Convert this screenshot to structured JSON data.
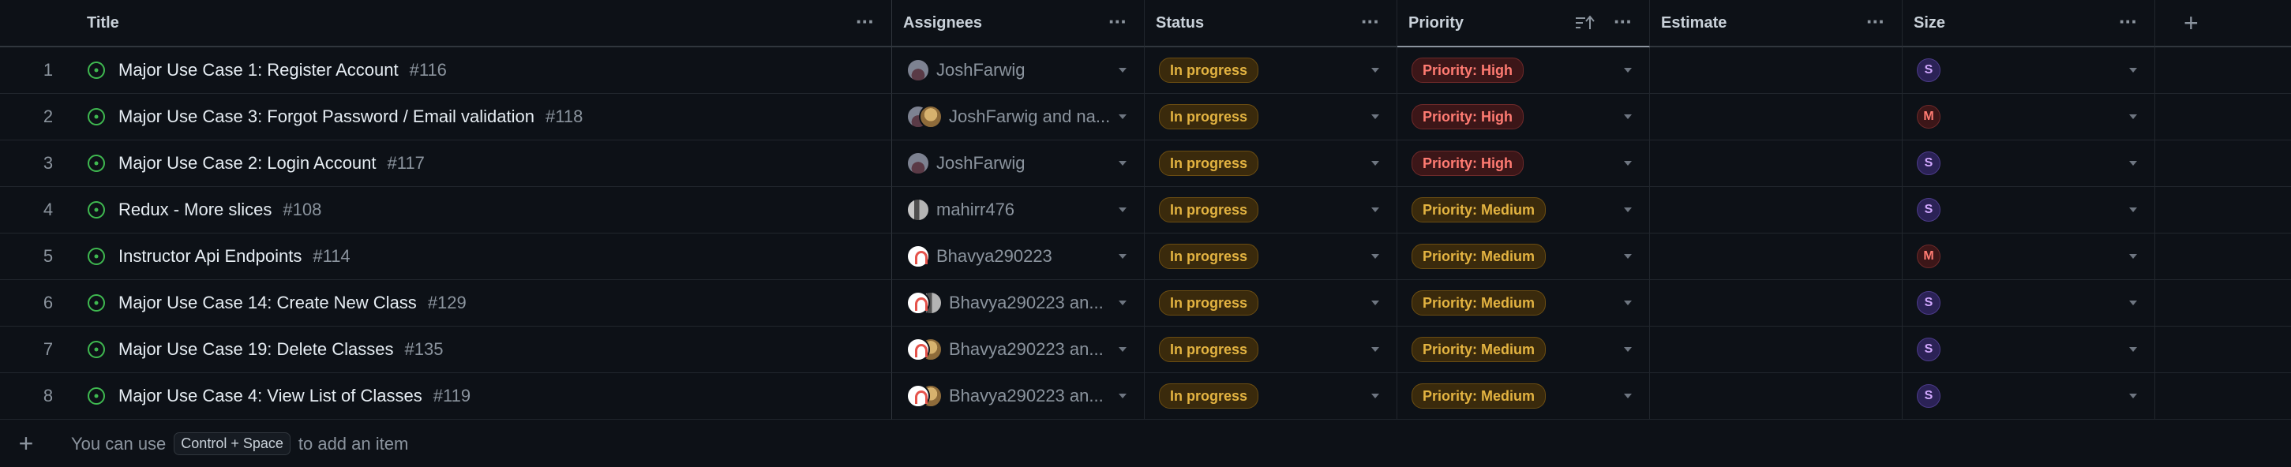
{
  "columns": {
    "title": "Title",
    "assignees": "Assignees",
    "status": "Status",
    "priority": "Priority",
    "estimate": "Estimate",
    "size": "Size",
    "add_field": "+"
  },
  "rows": [
    {
      "num": "1",
      "title": "Major Use Case 1: Register Account",
      "issue": "#116",
      "assignees": "JoshFarwig",
      "avatars": [
        "josh"
      ],
      "status": "In progress",
      "priority": "Priority: High",
      "priority_level": "high",
      "size": "S"
    },
    {
      "num": "2",
      "title": "Major Use Case 3: Forgot Password / Email validation",
      "issue": "#118",
      "assignees": "JoshFarwig and na...",
      "avatars": [
        "josh",
        "nat"
      ],
      "status": "In progress",
      "priority": "Priority: High",
      "priority_level": "high",
      "size": "M"
    },
    {
      "num": "3",
      "title": "Major Use Case 2: Login Account",
      "issue": "#117",
      "assignees": "JoshFarwig",
      "avatars": [
        "josh"
      ],
      "status": "In progress",
      "priority": "Priority: High",
      "priority_level": "high",
      "size": "S"
    },
    {
      "num": "4",
      "title": "Redux - More slices",
      "issue": "#108",
      "assignees": "mahirr476",
      "avatars": [
        "mahi"
      ],
      "status": "In progress",
      "priority": "Priority: Medium",
      "priority_level": "medium",
      "size": "S"
    },
    {
      "num": "5",
      "title": "Instructor Api Endpoints",
      "issue": "#114",
      "assignees": "Bhavya290223",
      "avatars": [
        "bhav"
      ],
      "status": "In progress",
      "priority": "Priority: Medium",
      "priority_level": "medium",
      "size": "M"
    },
    {
      "num": "6",
      "title": "Major Use Case 14: Create New Class",
      "issue": "#129",
      "assignees": "Bhavya290223 an...",
      "avatars": [
        "bhav",
        "mahi"
      ],
      "status": "In progress",
      "priority": "Priority: Medium",
      "priority_level": "medium",
      "size": "S"
    },
    {
      "num": "7",
      "title": "Major Use Case 19: Delete Classes",
      "issue": "#135",
      "assignees": "Bhavya290223 an...",
      "avatars": [
        "bhav",
        "nat"
      ],
      "status": "In progress",
      "priority": "Priority: Medium",
      "priority_level": "medium",
      "size": "S"
    },
    {
      "num": "8",
      "title": "Major Use Case 4: View List of Classes",
      "issue": "#119",
      "assignees": "Bhavya290223 an...",
      "avatars": [
        "bhav",
        "nat"
      ],
      "status": "In progress",
      "priority": "Priority: Medium",
      "priority_level": "medium",
      "size": "S"
    }
  ],
  "footer": {
    "add_icon": "+",
    "text_before": "You can use",
    "shortcut": "Control + Space",
    "text_after": "to add an item"
  },
  "icons": {
    "issue": "open-issue-icon",
    "menu": "more-horizontal-icon",
    "sort": "sort-ascending-icon",
    "caret": "caret-down-icon",
    "add": "plus-icon"
  },
  "colors": {
    "background": "#0d1117",
    "status_bg": "#3a2a0c",
    "status_fg": "#e3b341",
    "high_fg": "#ff7b72",
    "size_s": "#d2a8ff",
    "issue_open": "#3fb950"
  }
}
